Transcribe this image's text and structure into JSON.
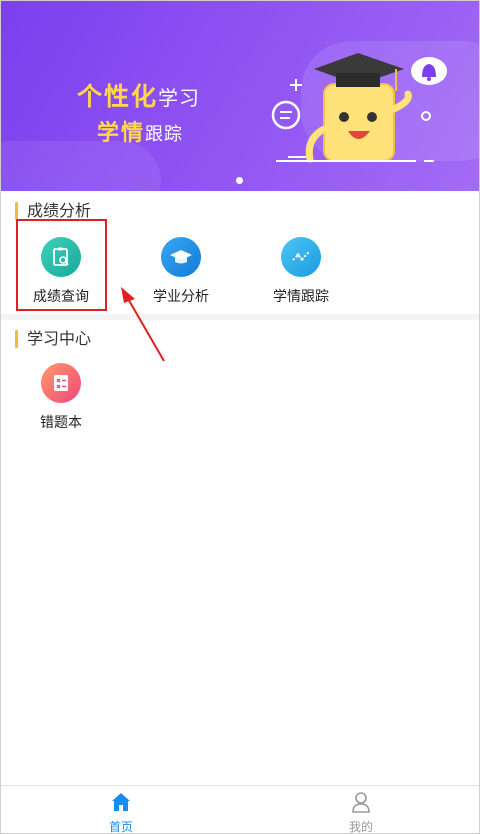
{
  "banner": {
    "line1_bold": "个性化",
    "line1_light": "学习",
    "line2_bold": "学情",
    "line2_light": "跟踪"
  },
  "sections": {
    "score_analysis": {
      "title": "成绩分析",
      "items": [
        {
          "label": "成绩查询",
          "icon": "clipboard-search-icon"
        },
        {
          "label": "学业分析",
          "icon": "graduation-cap-icon"
        },
        {
          "label": "学情跟踪",
          "icon": "trend-line-icon"
        }
      ]
    },
    "learning_center": {
      "title": "学习中心",
      "items": [
        {
          "label": "错题本",
          "icon": "wrong-questions-notebook-icon"
        }
      ]
    }
  },
  "tabbar": {
    "home_label": "首页",
    "me_label": "我的"
  },
  "colors": {
    "banner_gradient_start": "#7b3ff0",
    "banner_gradient_end": "#a36bf6",
    "slogan_yellow": "#ffd84a",
    "section_accent": "#f5b93c",
    "active_tab": "#1a8cf0",
    "inactive_tab": "#9a9a9a",
    "annotation_red": "#e02020"
  }
}
